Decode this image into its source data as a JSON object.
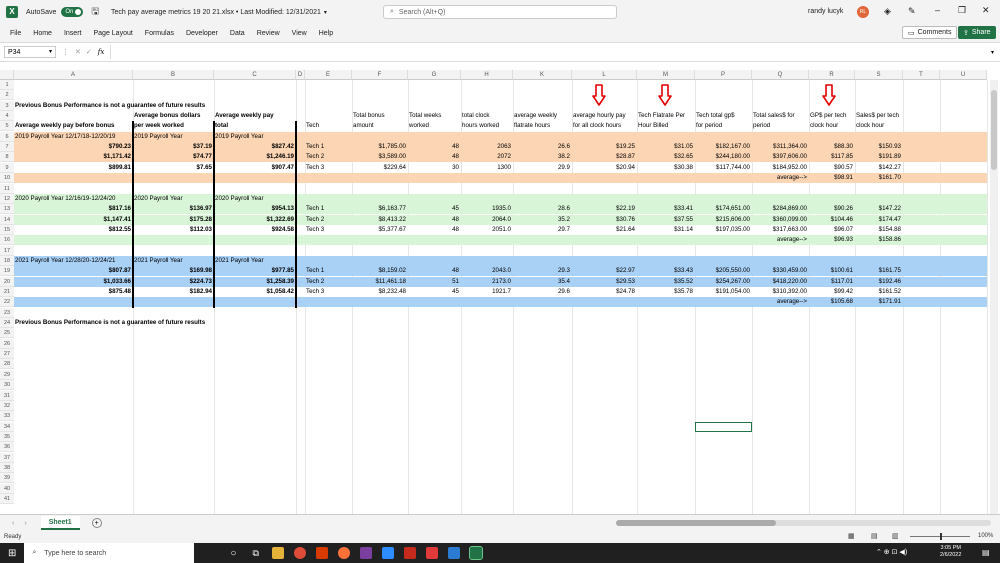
{
  "titlebar": {
    "autosave_label": "AutoSave",
    "autosave_state": "On",
    "file_title": "Tech pay average metrics 19 20 21.xlsx • Last Modified: 12/31/2021",
    "search_placeholder": "Search (Alt+Q)",
    "user_name": "randy lucyk",
    "user_initials": "RL"
  },
  "ribbon": {
    "tabs": [
      "File",
      "Home",
      "Insert",
      "Page Layout",
      "Formulas",
      "Developer",
      "Data",
      "Review",
      "View",
      "Help"
    ],
    "comments_label": "Comments",
    "share_label": "Share"
  },
  "formula_bar": {
    "name_box": "P34",
    "fx": "fx"
  },
  "columns": [
    "A",
    "B",
    "C",
    "D",
    "E",
    "F",
    "G",
    "H",
    "K",
    "L",
    "M",
    "P",
    "Q",
    "R",
    "S",
    "T",
    "U"
  ],
  "row_numbers": [
    "1",
    "2",
    "3",
    "4",
    "5",
    "6",
    "7",
    "8",
    "9",
    "10",
    "11",
    "12",
    "13",
    "14",
    "15",
    "16",
    "17",
    "18",
    "19",
    "20",
    "21",
    "22",
    "23",
    "24",
    "25",
    "26",
    "27",
    "28",
    "29",
    "30",
    "31",
    "32",
    "33",
    "34",
    "35",
    "36",
    "37",
    "38",
    "39",
    "40",
    "41"
  ],
  "disclaimer": "Previous Bonus Performance is not a guarantee of future results",
  "headers": {
    "a": "Average weekly pay before bonus",
    "b1": "Average bonus dollars",
    "b2": "per week worked",
    "c1": "Average weekly pay",
    "c2": "total",
    "e": "Tech",
    "f1": "Total bonus",
    "f2": "amount",
    "g1": "Total weeks",
    "g2": "worked",
    "h1": "total clock",
    "h2": "hours worked",
    "k1": "average weekly",
    "k2": "flatrate hours",
    "l1": "average hourly pay",
    "l2": "for all clock hours",
    "m1": "Tech Flatrate Per",
    "m2": "Hour Billed",
    "p1": "Tech total gp$",
    "p2": "for period",
    "q1": "Total sales$ for",
    "q2": "period",
    "r1": "GP$ per tech",
    "r2": "clock hour",
    "s1": "Sales$ per tech",
    "s2": "clock hour"
  },
  "years": [
    {
      "label_a": "2019 Payroll Year  12/17/18-12/20/19",
      "label_b": "2019 Payroll Year",
      "label_c": "2019 Payroll Year",
      "rows": [
        {
          "a": "$790.23",
          "b": "$37.19",
          "c": "$827.42",
          "e": "Tech 1",
          "f": "$1,785.00",
          "g": "48",
          "h": "2063",
          "k": "26.6",
          "l": "$19.25",
          "m": "$31.05",
          "p": "$182,167.00",
          "q": "$311,364.00",
          "r": "$88.30",
          "s": "$150.93"
        },
        {
          "a": "$1,171.42",
          "b": "$74.77",
          "c": "$1,246.19",
          "e": "Tech 2",
          "f": "$3,589.00",
          "g": "48",
          "h": "2072",
          "k": "38.2",
          "l": "$28.87",
          "m": "$32.65",
          "p": "$244,180.00",
          "q": "$397,606.00",
          "r": "$117.85",
          "s": "$191.89"
        },
        {
          "a": "$899.81",
          "b": "$7.65",
          "c": "$907.47",
          "e": "Tech 3",
          "f": "$229.64",
          "g": "30",
          "h": "1300",
          "k": "29.9",
          "l": "$20.94",
          "m": "$30.38",
          "p": "$117,744.00",
          "q": "$184,952.00",
          "r": "$90.57",
          "s": "$142.27"
        }
      ],
      "avg_label": "average-->",
      "avg_r": "$98.91",
      "avg_s": "$161.70"
    },
    {
      "label_a": "2020 Payroll Year  12/16/19-12/24/20",
      "label_b": "2020 Payroll Year",
      "label_c": "2020 Payroll Year",
      "rows": [
        {
          "a": "$817.16",
          "b": "$136.97",
          "c": "$954.13",
          "e": "Tech 1",
          "f": "$6,163.77",
          "g": "45",
          "h": "1935.0",
          "k": "28.6",
          "l": "$22.19",
          "m": "$33.41",
          "p": "$174,651.00",
          "q": "$284,869.00",
          "r": "$90.26",
          "s": "$147.22"
        },
        {
          "a": "$1,147.41",
          "b": "$175.28",
          "c": "$1,322.69",
          "e": "Tech 2",
          "f": "$8,413.22",
          "g": "48",
          "h": "2064.0",
          "k": "35.2",
          "l": "$30.76",
          "m": "$37.55",
          "p": "$215,606.00",
          "q": "$360,099.00",
          "r": "$104.46",
          "s": "$174.47"
        },
        {
          "a": "$812.55",
          "b": "$112.03",
          "c": "$924.58",
          "e": "Tech 3",
          "f": "$5,377.67",
          "g": "48",
          "h": "2051.0",
          "k": "29.7",
          "l": "$21.64",
          "m": "$31.14",
          "p": "$197,035.00",
          "q": "$317,663.00",
          "r": "$96.07",
          "s": "$154.88"
        }
      ],
      "avg_label": "average-->",
      "avg_r": "$96.93",
      "avg_s": "$158.86"
    },
    {
      "label_a": "2021 Payroll Year 12/28/20-12/24/21",
      "label_b": "2021 Payroll Year",
      "label_c": "2021 Payroll Year",
      "rows": [
        {
          "a": "$807.87",
          "b": "$169.98",
          "c": "$977.85",
          "e": "Tech 1",
          "f": "$8,159.02",
          "g": "48",
          "h": "2043.0",
          "k": "29.3",
          "l": "$22.97",
          "m": "$33.43",
          "p": "$205,550.00",
          "q": "$330,459.00",
          "r": "$100.61",
          "s": "$161.75"
        },
        {
          "a": "$1,033.66",
          "b": "$224.73",
          "c": "$1,258.39",
          "e": "Tech 2",
          "f": "$11,461.18",
          "g": "51",
          "h": "2173.0",
          "k": "35.4",
          "l": "$29.53",
          "m": "$35.52",
          "p": "$254,267.00",
          "q": "$418,220.00",
          "r": "$117.01",
          "s": "$192.46"
        },
        {
          "a": "$875.48",
          "b": "$182.94",
          "c": "$1,058.42",
          "e": "Tech 3",
          "f": "$8,232.48",
          "g": "45",
          "h": "1921.7",
          "k": "29.6",
          "l": "$24.78",
          "m": "$35.78",
          "p": "$191,054.00",
          "q": "$310,392.00",
          "r": "$99.42",
          "s": "$161.52"
        }
      ],
      "avg_label": "average-->",
      "avg_r": "$105.68",
      "avg_s": "$171.91"
    }
  ],
  "sheet_tab": "Sheet1",
  "status": {
    "ready": "Ready",
    "zoom": "100%"
  },
  "taskbar": {
    "search_placeholder": "Type here to search",
    "time": "3:05 PM",
    "date": "2/6/2022"
  },
  "colors": {
    "excel_green": "#217346",
    "orange_band": "#fcd5b4",
    "green_band": "#d8f5d8",
    "blue_band": "#a9d0f5",
    "arrow_red": "#e00000"
  }
}
